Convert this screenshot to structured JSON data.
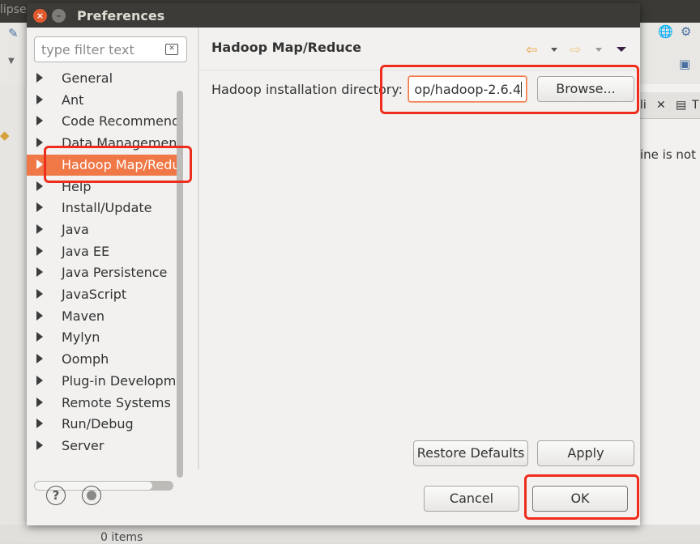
{
  "background": {
    "window_title": "lipse",
    "right_tab_label": "li",
    "right_tab_label2": "T",
    "right_message": "ine is not a",
    "status_text": "0 items"
  },
  "dialog": {
    "title": "Preferences",
    "close_glyph": "×",
    "minimize_glyph": "–",
    "filter": {
      "placeholder": "type filter text",
      "clear_glyph": "✕"
    },
    "tree": [
      {
        "label": "General"
      },
      {
        "label": "Ant"
      },
      {
        "label": "Code Recommend"
      },
      {
        "label": "Data Management"
      },
      {
        "label": "Hadoop Map/Redu",
        "selected": true
      },
      {
        "label": "Help"
      },
      {
        "label": "Install/Update"
      },
      {
        "label": "Java"
      },
      {
        "label": "Java EE"
      },
      {
        "label": "Java Persistence"
      },
      {
        "label": "JavaScript"
      },
      {
        "label": "Maven"
      },
      {
        "label": "Mylyn"
      },
      {
        "label": "Oomph"
      },
      {
        "label": "Plug-in Developme"
      },
      {
        "label": "Remote Systems"
      },
      {
        "label": "Run/Debug"
      },
      {
        "label": "Server"
      }
    ],
    "page": {
      "title": "Hadoop Map/Reduce",
      "back_glyph": "⇦",
      "forward_glyph": "⇨",
      "field_label": "Hadoop installation directory:",
      "field_value": "op/hadoop-2.6.4",
      "browse_label": "Browse...",
      "restore_defaults_label": "Restore Defaults",
      "apply_label": "Apply"
    },
    "footer": {
      "help_glyph": "?",
      "cancel_label": "Cancel",
      "ok_label": "OK"
    }
  },
  "colors": {
    "selection": "#f07746",
    "highlight_box": "#ef2d1c",
    "title_bar": "#3c3b37"
  }
}
